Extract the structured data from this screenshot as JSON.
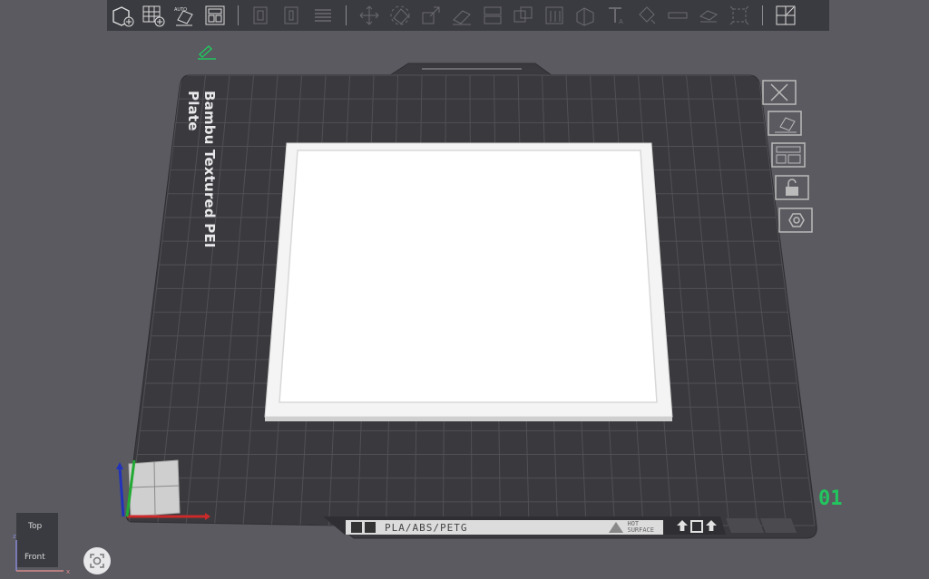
{
  "toolbar": {
    "icons": [
      "add-object-icon",
      "add-plate-icon",
      "auto-orient-icon",
      "arrange-icon",
      "copy-icon",
      "paste-icon",
      "layers-icon",
      "move-icon",
      "rotate-icon",
      "scale-icon",
      "lay-on-face-icon",
      "cut-icon",
      "boolean-icon",
      "support-paint-icon",
      "seam-paint-icon",
      "text-icon",
      "color-paint-icon",
      "measure-icon",
      "assembly-icon",
      "split-icon",
      "explode-icon"
    ]
  },
  "plate": {
    "name": "Bambu Textured PEI Plate",
    "number": "01",
    "filament_label": "PLA/ABS/PETG",
    "warning_line1": "HOT",
    "warning_line2": "SURFACE"
  },
  "view_cube": {
    "top_label": "Top",
    "front_label": "Front",
    "axis_z": "z",
    "axis_x": "x"
  },
  "colors": {
    "accent": "#22c55e",
    "bed": "#3c3c40",
    "grid": "#55555a",
    "object": "#ffffff",
    "x_axis": "#cc2a2a",
    "y_axis": "#22aa33",
    "z_axis": "#2233bb"
  }
}
